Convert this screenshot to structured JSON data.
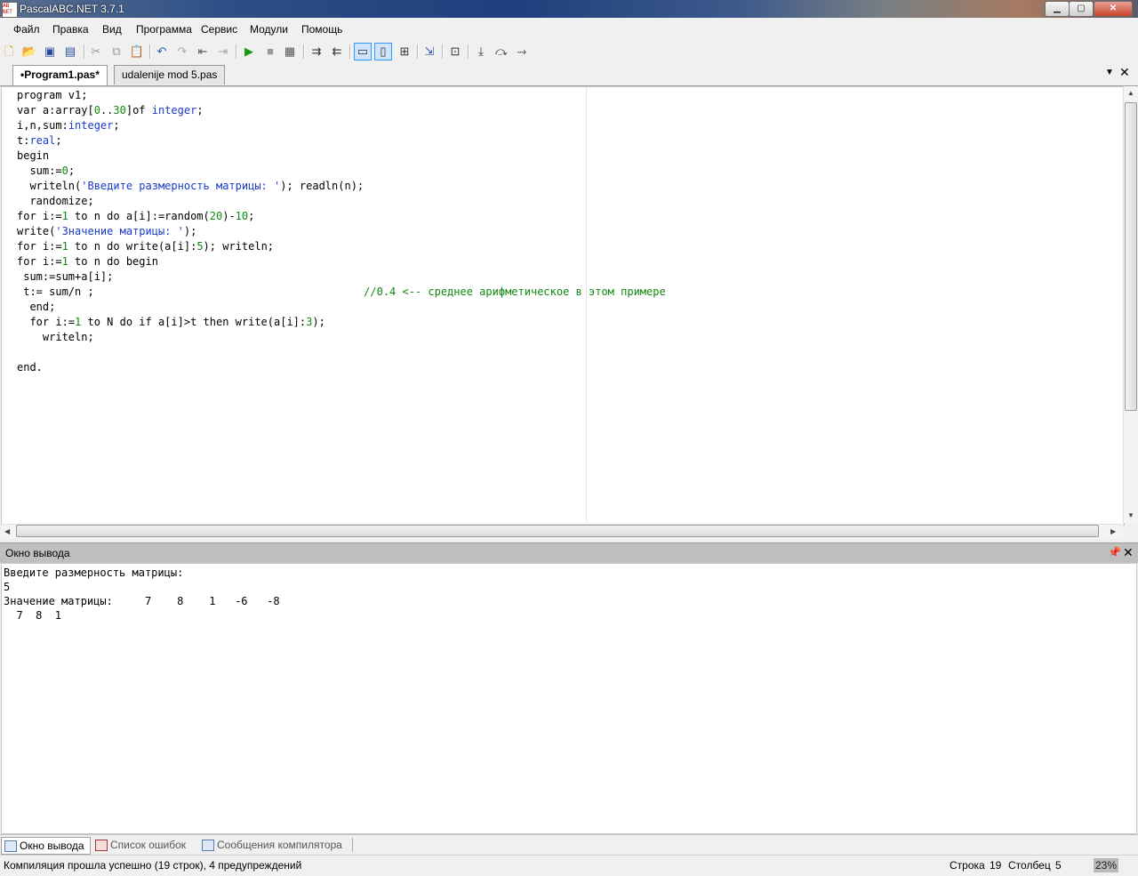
{
  "window": {
    "title": "PascalABC.NET 3.7.1",
    "icon_text": "AB NET"
  },
  "window_controls": {
    "minimize": "▁",
    "maximize": "▢",
    "close": "✕"
  },
  "menu": [
    "Файл",
    "Правка",
    "Вид",
    "Программа",
    "Сервис",
    "Модули",
    "Помощь"
  ],
  "toolbar_icons": [
    "new-file-icon",
    "open-folder-icon",
    "save-icon",
    "save-all-icon",
    "cut-icon",
    "copy-icon",
    "paste-icon",
    "undo-icon",
    "redo-icon",
    "step-back-icon",
    "step-forward-icon",
    "run-icon",
    "stop-icon",
    "compile-icon",
    "indent-icon",
    "outdent-icon",
    "view-code-icon",
    "view-text-icon",
    "view-form-icon",
    "exit-icon",
    "debug-icon",
    "step-into-icon",
    "step-over-icon",
    "run-to-cursor-icon"
  ],
  "tabs": [
    {
      "label": "•Program1.pas*",
      "active": true
    },
    {
      "label": "udalenije mod 5.pas",
      "active": false
    }
  ],
  "editor": {
    "lines": [
      "program v1;",
      "var a:array[0..30]of integer;",
      "i,n,sum:integer;",
      "t:real;",
      "begin",
      "  sum:=0;",
      "  writeln('Введите размерность матрицы: '); readln(n);",
      "  randomize;",
      "for i:=1 to n do a[i]:=random(20)-10;",
      "write('Значение матрицы: ');",
      "for i:=1 to n do write(a[i]:5); writeln;",
      "for i:=1 to n do begin",
      " sum:=sum+a[i];",
      " t:= sum/n ;                                          //0.4 <-- среднее арифметическое в этом примере",
      "  end;",
      "  for i:=1 to N do if a[i]>t then write(a[i]:3);",
      "    writeln;",
      "",
      "end."
    ]
  },
  "output_panel": {
    "title": "Окно вывода",
    "lines": [
      "Введите размерность матрицы:",
      "5",
      "Значение матрицы:     7    8    1   -6   -8",
      "  7  8  1"
    ]
  },
  "bottom_tabs": [
    "Окно вывода",
    "Список ошибок",
    "Сообщения компилятора"
  ],
  "status": {
    "message": "Компиляция прошла успешно (19 строк), 4 предупреждений",
    "row_label": "Строка",
    "row": "19",
    "col_label": "Столбец",
    "col": "5",
    "zoom": "23%"
  },
  "colors": {
    "keyword": "#000000",
    "type": "#1a3acb",
    "number": "#118811",
    "comment": "#118811",
    "string": "#1a3acb"
  }
}
